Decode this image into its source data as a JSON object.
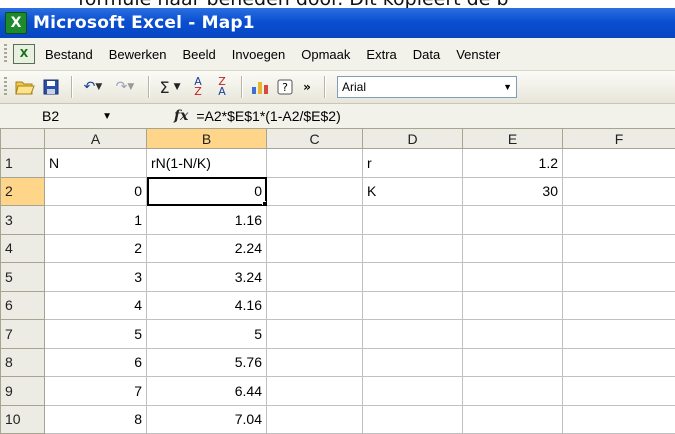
{
  "page_overlay_text": "formule naar beneden door. Dit kopieert de b",
  "window": {
    "title": "Microsoft Excel - Map1",
    "app_icon_glyph": "X"
  },
  "menu": [
    "Bestand",
    "Bewerken",
    "Beeld",
    "Invoegen",
    "Opmaak",
    "Extra",
    "Data",
    "Venster"
  ],
  "toolbar": {
    "font_name": "Arial",
    "icons": [
      "open-icon",
      "save-icon",
      "undo-icon",
      "redo-icon",
      "autosum-icon",
      "sort-ascending-icon",
      "sort-descending-icon",
      "chart-wizard-icon",
      "help-icon",
      "more-buttons-icon"
    ],
    "sum_glyph": "Σ",
    "overflow_glyph": "»"
  },
  "formula_bar": {
    "name_box": "B2",
    "fx_label": "fx",
    "formula": "=A2*$E$1*(1-A2/$E$2)"
  },
  "sheet": {
    "columns": [
      "A",
      "B",
      "C",
      "D",
      "E",
      "F"
    ],
    "selected_cell": "B2",
    "rows": [
      {
        "num": "1",
        "A": "N",
        "B": "rN(1-N/K)",
        "C": "",
        "D": "r",
        "E": "1.2",
        "F": ""
      },
      {
        "num": "2",
        "A": "0",
        "B": "0",
        "C": "",
        "D": "K",
        "E": "30",
        "F": ""
      },
      {
        "num": "3",
        "A": "1",
        "B": "1.16",
        "C": "",
        "D": "",
        "E": "",
        "F": ""
      },
      {
        "num": "4",
        "A": "2",
        "B": "2.24",
        "C": "",
        "D": "",
        "E": "",
        "F": ""
      },
      {
        "num": "5",
        "A": "3",
        "B": "3.24",
        "C": "",
        "D": "",
        "E": "",
        "F": ""
      },
      {
        "num": "6",
        "A": "4",
        "B": "4.16",
        "C": "",
        "D": "",
        "E": "",
        "F": ""
      },
      {
        "num": "7",
        "A": "5",
        "B": "5",
        "C": "",
        "D": "",
        "E": "",
        "F": ""
      },
      {
        "num": "8",
        "A": "6",
        "B": "5.76",
        "C": "",
        "D": "",
        "E": "",
        "F": ""
      },
      {
        "num": "9",
        "A": "7",
        "B": "6.44",
        "C": "",
        "D": "",
        "E": "",
        "F": ""
      },
      {
        "num": "10",
        "A": "8",
        "B": "7.04",
        "C": "",
        "D": "",
        "E": "",
        "F": ""
      }
    ]
  }
}
